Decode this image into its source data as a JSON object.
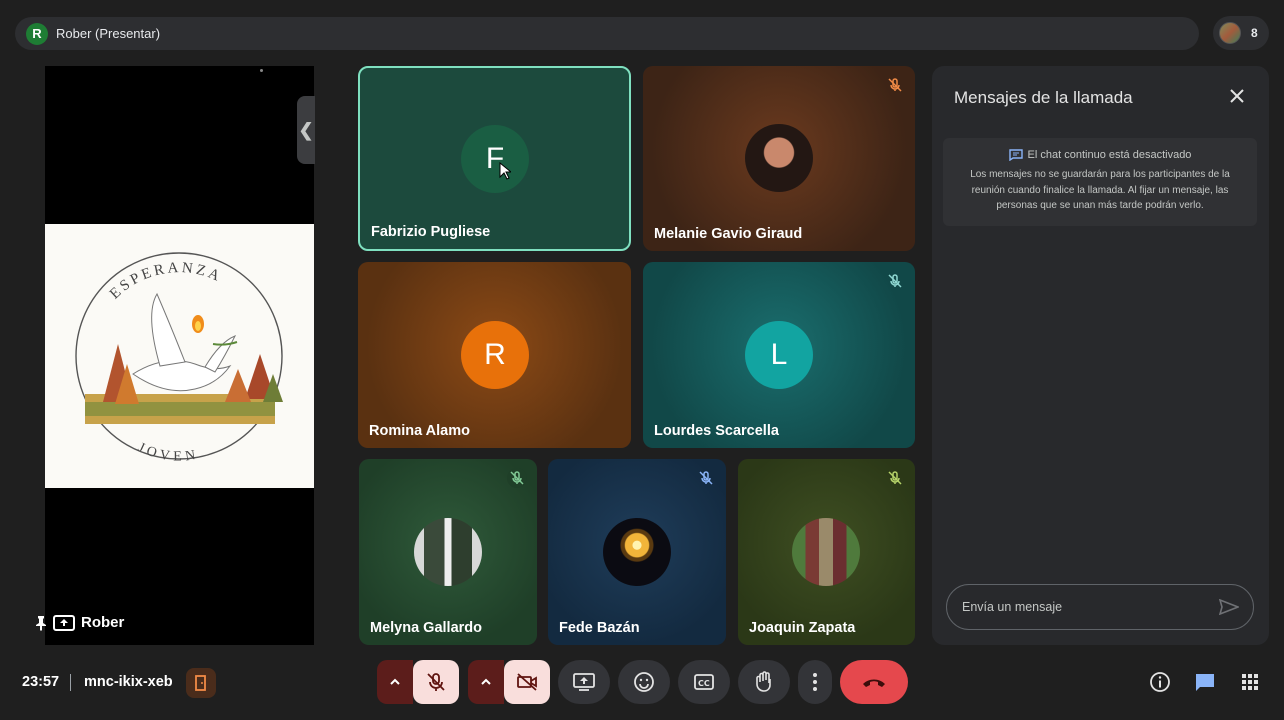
{
  "header": {
    "presenter_initial": "R",
    "presenter_label": "Rober (Presentar)",
    "participant_count": "8"
  },
  "presentation": {
    "presenter_name": "Rober",
    "slide_text_top": "ESPERANZA",
    "slide_text_bottom": "JOVEN"
  },
  "tiles": [
    {
      "name": "Fabrizio Pugliese",
      "initial": "F",
      "avatar_type": "letter",
      "muted": false,
      "active_speaker": true
    },
    {
      "name": "Melanie Gavio Giraud",
      "avatar_type": "photo",
      "muted": true
    },
    {
      "name": "Romina Alamo",
      "initial": "R",
      "avatar_type": "letter",
      "muted": false
    },
    {
      "name": "Lourdes Scarcella",
      "initial": "L",
      "avatar_type": "letter",
      "muted": true
    },
    {
      "name": "Melyna Gallardo",
      "avatar_type": "photo",
      "muted": true
    },
    {
      "name": "Fede Bazán",
      "avatar_type": "photo",
      "muted": true
    },
    {
      "name": "Joaquin Zapata",
      "avatar_type": "photo",
      "muted": true
    }
  ],
  "chat": {
    "title": "Mensajes de la llamada",
    "notice_title": "El chat continuo está desactivado",
    "notice_body": "Los mensajes no se guardarán para los participantes de la reunión cuando finalice la llamada. Al fijar un mensaje, las personas que se unan más tarde podrán verlo.",
    "input_placeholder": "Envía un mensaje"
  },
  "bottom": {
    "time": "23:57",
    "meeting_code": "mnc-ikix-xeb"
  },
  "colors": {
    "background": "#1f1f1f",
    "end_call": "#e5484d",
    "mic_off_bg": "#f9dedc",
    "chat_active": "#8ab4f8"
  }
}
